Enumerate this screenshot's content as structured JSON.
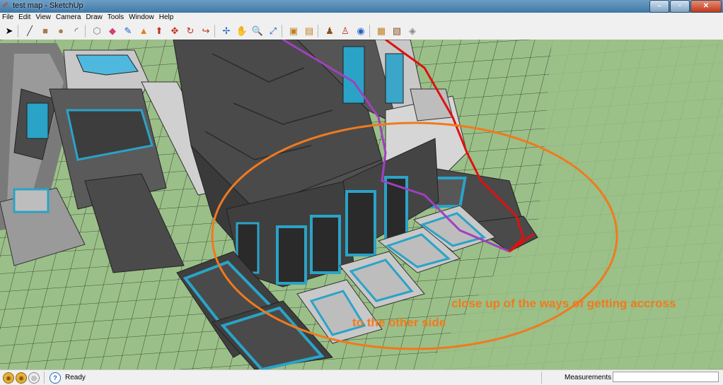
{
  "window": {
    "title": "test map - SketchUp",
    "minimize": "–",
    "maximize": "▫",
    "close": "✕"
  },
  "menu": [
    "File",
    "Edit",
    "View",
    "Camera",
    "Draw",
    "Tools",
    "Window",
    "Help"
  ],
  "toolbar": {
    "tools": [
      {
        "name": "select-tool-icon",
        "glyph": "➤"
      },
      {
        "name": "line-tool-icon",
        "glyph": "╱"
      },
      {
        "name": "rectangle-tool-icon",
        "glyph": "■"
      },
      {
        "name": "circle-tool-icon",
        "glyph": "●"
      },
      {
        "name": "arc-tool-icon",
        "glyph": "◜"
      },
      {
        "name": "make-component-tool-icon",
        "glyph": "⬡"
      },
      {
        "name": "eraser-tool-icon",
        "glyph": "◆"
      },
      {
        "name": "tape-measure-tool-icon",
        "glyph": "✎"
      },
      {
        "name": "paint-bucket-tool-icon",
        "glyph": "▲"
      },
      {
        "name": "push-pull-tool-icon",
        "glyph": "⬆"
      },
      {
        "name": "move-tool-icon",
        "glyph": "✥"
      },
      {
        "name": "rotate-tool-icon",
        "glyph": "↻"
      },
      {
        "name": "follow-me-tool-icon",
        "glyph": "↪"
      },
      {
        "name": "orbit-tool-icon",
        "glyph": "✢"
      },
      {
        "name": "pan-tool-icon",
        "glyph": "✋"
      },
      {
        "name": "zoom-tool-icon",
        "glyph": "🔍"
      },
      {
        "name": "zoom-extents-tool-icon",
        "glyph": "⤢"
      },
      {
        "name": "previous-view-tool-icon",
        "glyph": "▣"
      },
      {
        "name": "next-view-tool-icon",
        "glyph": "▤"
      },
      {
        "name": "position-camera-tool-icon",
        "glyph": "♟"
      },
      {
        "name": "walk-tool-icon",
        "glyph": "♙"
      },
      {
        "name": "look-around-tool-icon",
        "glyph": "◉"
      },
      {
        "name": "get-models-tool-icon",
        "glyph": "▦"
      },
      {
        "name": "share-model-tool-icon",
        "glyph": "▧"
      },
      {
        "name": "components-tool-icon",
        "glyph": "◈"
      }
    ],
    "icon_colors": {
      "select": "#000000",
      "line": "#555555",
      "rectangle": "#a67c4a",
      "circle": "#a67c4a",
      "accent_red": "#c02020",
      "accent_blue": "#2060c0",
      "accent_orange": "#e08020"
    }
  },
  "scene": {
    "ground_color": "#9bbf88",
    "grid_color": "#1e2a18",
    "dark_block_color": "#4a4a4a",
    "light_block_color": "#bdbdbd",
    "teal_accent_color": "#2aa3c7",
    "purple_line_color": "#a040c0",
    "red_line_color": "#e01010",
    "annotation_color": "#f07a1e"
  },
  "annotation": {
    "line1": "close up of the ways of getting accross",
    "line2": "to the other side"
  },
  "status": {
    "text": "Ready",
    "measurements_label": "Measurements",
    "measurements_value": ""
  }
}
